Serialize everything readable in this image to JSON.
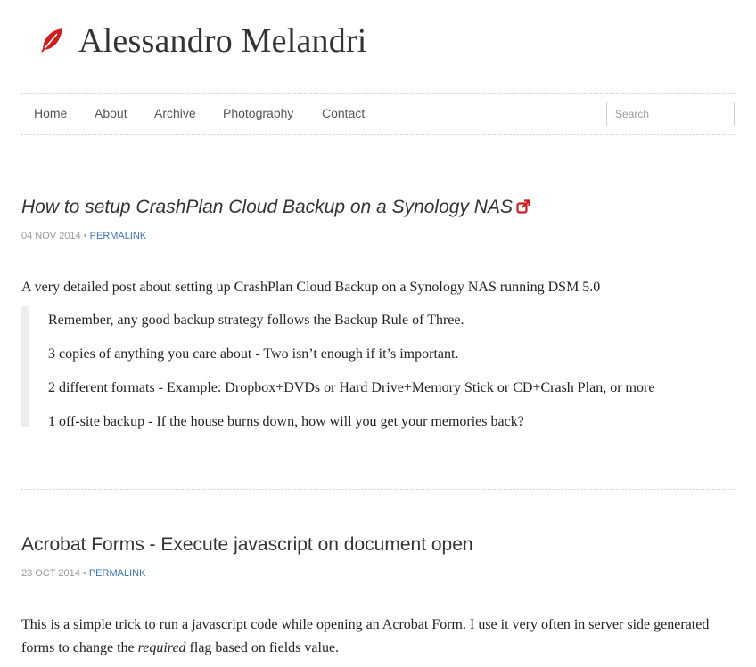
{
  "site": {
    "title": "Alessandro Melandri",
    "logo_icon": "red-leaf-icon",
    "accent_color": "#cc1f1f"
  },
  "nav": {
    "items": [
      {
        "label": "Home"
      },
      {
        "label": "About"
      },
      {
        "label": "Archive"
      },
      {
        "label": "Photography"
      },
      {
        "label": "Contact"
      }
    ],
    "search_placeholder": "Search"
  },
  "posts": [
    {
      "title": "How to setup CrashPlan Cloud Backup on a Synology NAS",
      "external_link_icon": "external-link-icon",
      "date": "04 NOV 2014",
      "separator": "•",
      "permalink_label": "PERMALINK",
      "intro": "A very detailed post about setting up CrashPlan Cloud Backup on a Synology NAS running DSM 5.0",
      "quote": [
        "Remember, any good backup strategy follows the Backup Rule of Three.",
        "3 copies of anything you care about - Two isn’t enough if it’s important.",
        "2 different formats - Example: Dropbox+DVDs or Hard Drive+Memory Stick or CD+Crash Plan, or more",
        "1 off-site backup - If the house burns down, how will you get your memories back?"
      ]
    },
    {
      "title": "Acrobat Forms - Execute javascript on document open",
      "date": "23 OCT 2014",
      "separator": "•",
      "permalink_label": "PERMALINK",
      "body_before": "This is a simple trick to run a javascript code while opening an Acrobat Form. I use it very often in server side generated forms to change the ",
      "body_em": "required",
      "body_after": " flag based on fields value."
    }
  ]
}
